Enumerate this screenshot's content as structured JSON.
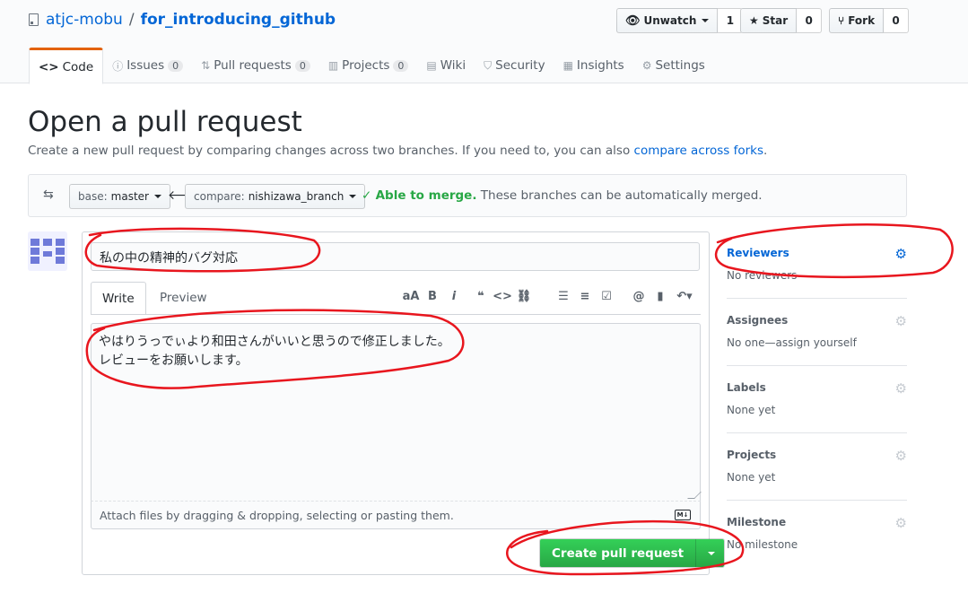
{
  "repo": {
    "owner": "atjc-mobu",
    "separator": "/",
    "name": "for_introducing_github"
  },
  "actions": {
    "watch_label": "Unwatch",
    "watch_count": "1",
    "star_label": "Star",
    "star_count": "0",
    "fork_label": "Fork",
    "fork_count": "0"
  },
  "tabs": [
    {
      "label": "Code",
      "icon": "code-icon"
    },
    {
      "label": "Issues",
      "count": "0",
      "icon": "issue-icon"
    },
    {
      "label": "Pull requests",
      "count": "0",
      "icon": "pull-request-icon"
    },
    {
      "label": "Projects",
      "count": "0",
      "icon": "project-icon"
    },
    {
      "label": "Wiki",
      "icon": "book-icon"
    },
    {
      "label": "Security",
      "icon": "shield-icon"
    },
    {
      "label": "Insights",
      "icon": "graph-icon"
    },
    {
      "label": "Settings",
      "icon": "gear-icon"
    }
  ],
  "page": {
    "title": "Open a pull request",
    "subtitle": "Create a new pull request by comparing changes across two branches. If you need to, you can also ",
    "subtitle_link": "compare across forks",
    "subtitle_end": "."
  },
  "range": {
    "base_label": "base:",
    "base_value": "master",
    "compare_label": "compare:",
    "compare_value": "nishizawa_branch",
    "merge_status": "Able to merge.",
    "merge_text": "These branches can be automatically merged."
  },
  "form": {
    "title_value": "私の中の精神的バグ対応",
    "write_tab": "Write",
    "preview_tab": "Preview",
    "body_lines": [
      "やはりうっでぃより和田さんがいいと思うので修正しました。",
      "レビューをお願いします。"
    ],
    "attach_text": "Attach files by dragging & dropping, selecting or pasting them.",
    "submit_label": "Create pull request"
  },
  "sidebar": {
    "reviewers": {
      "label": "Reviewers",
      "value": "No reviewers"
    },
    "assignees": {
      "label": "Assignees",
      "value": "No one—assign yourself"
    },
    "labels": {
      "label": "Labels",
      "value": "None yet"
    },
    "projects": {
      "label": "Projects",
      "value": "None yet"
    },
    "milestone": {
      "label": "Milestone",
      "value": "No milestone"
    }
  },
  "colors": {
    "link": "#0366d6",
    "success": "#28a745",
    "tab_accent": "#e36209",
    "annotation": "#e8161e"
  }
}
